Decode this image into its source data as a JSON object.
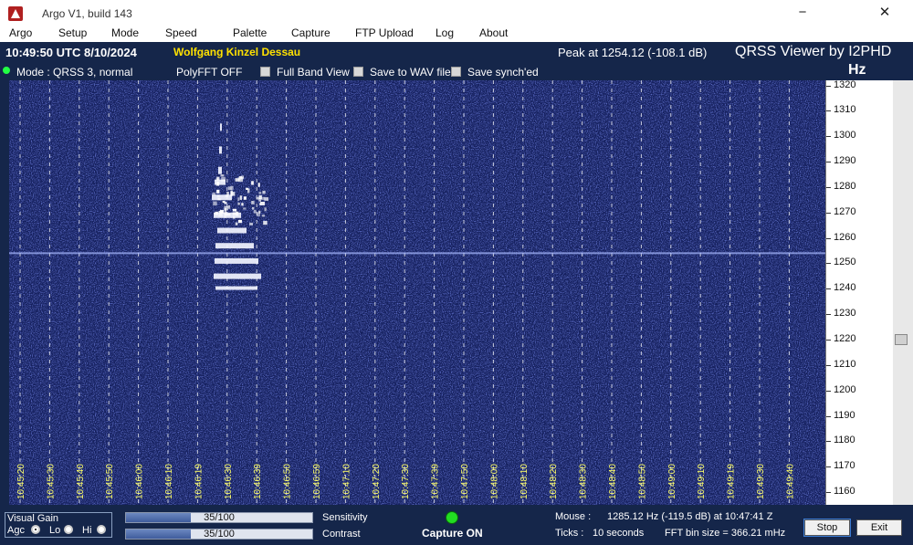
{
  "window": {
    "title": "Argo V1, build 143",
    "minimize": "−",
    "close": "✕"
  },
  "menu": [
    "Argo",
    "Setup",
    "Mode",
    "Speed",
    "Palette",
    "Capture",
    "FTP Upload",
    "Log",
    "About"
  ],
  "header": {
    "clock": "10:49:50 UTC  8/10/2024",
    "station": "Wolfgang Kinzel Dessau",
    "peak": "Peak at    1254.12 (-108.1 dB)",
    "brand": "QRSS Viewer by I2PHD",
    "unit": "Hz"
  },
  "options": {
    "mode": "Mode : QRSS 3, normal",
    "polyfft": "PolyFFT OFF",
    "full_band": "Full Band View",
    "save_wav": "Save to WAV file",
    "save_synched": "Save synch'ed"
  },
  "waterfall": {
    "time_labels": [
      "10:45:20",
      "10:45:30",
      "10:45:40",
      "10:45:50",
      "10:46:00",
      "10:46:10",
      "10:46:19",
      "10:46:30",
      "10:46:39",
      "10:46:50",
      "10:46:59",
      "10:47:10",
      "10:47:20",
      "10:47:30",
      "10:47:39",
      "10:47:50",
      "10:48:00",
      "10:48:10",
      "10:48:20",
      "10:48:30",
      "10:48:40",
      "10:48:50",
      "10:49:00",
      "10:49:10",
      "10:49:19",
      "10:49:30",
      "10:49:40"
    ],
    "carrier_hz": 1254,
    "freq_min": 1155,
    "freq_max": 1322
  },
  "scale": {
    "labels": [
      "1320",
      "1310",
      "1300",
      "1290",
      "1280",
      "1270",
      "1260",
      "1250",
      "1240",
      "1230",
      "1220",
      "1210",
      "1200",
      "1190",
      "1180",
      "1170",
      "1160"
    ],
    "slider_level_hz": 1220
  },
  "footer": {
    "visual_gain": "Visual Gain",
    "agc": "Agc",
    "lo": "Lo",
    "hi": "Hi",
    "selected_gain": "agc",
    "sensitivity_value": "35/100",
    "sensitivity_fraction": 0.35,
    "sensitivity_label": "Sensitivity",
    "contrast_value": "35/100",
    "contrast_fraction": 0.35,
    "contrast_label": "Contrast",
    "capture": "Capture ON",
    "mouse_label": "Mouse :",
    "mouse_value": "1285.12 Hz   (-119.5 dB) at 10:47:41 Z",
    "ticks_label": "Ticks  :",
    "ticks_value": "10 seconds",
    "fft_value": "FFT bin size = 366.21 mHz",
    "stop": "Stop",
    "exit": "Exit"
  },
  "colors": {
    "background": "#15264a",
    "station": "#ffe100",
    "waterfall": "#1b2870",
    "grid": "#ffffff",
    "time_labels": "#ffff66"
  }
}
